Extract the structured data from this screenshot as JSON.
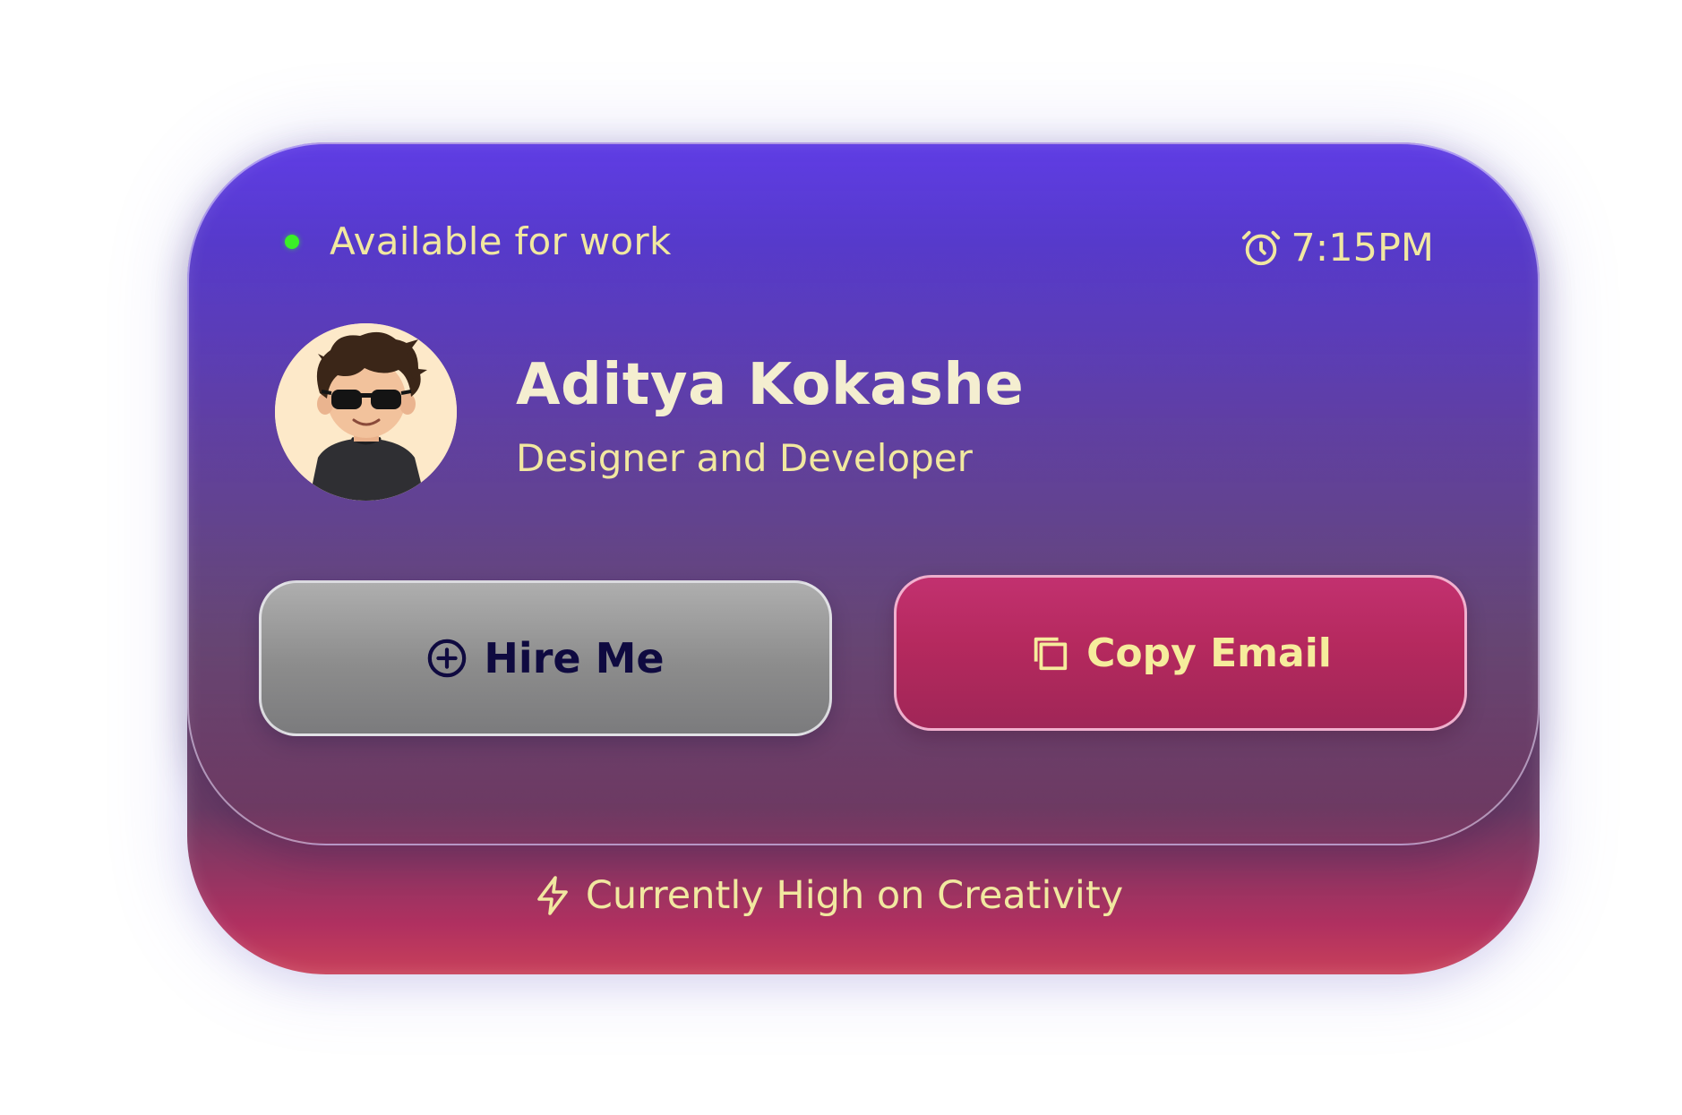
{
  "status": {
    "label": "Available for work",
    "dot_color": "#3af027"
  },
  "time": {
    "icon": "alarm-clock-icon",
    "value": "7:15PM"
  },
  "profile": {
    "name": "Aditya Kokashe",
    "role": "Designer and Developer",
    "avatar": "cartoon-avatar-with-sunglasses"
  },
  "buttons": {
    "hire": {
      "label": "Hire Me",
      "icon": "plus-circle-icon"
    },
    "copy": {
      "label": "Copy Email",
      "icon": "copy-icon"
    }
  },
  "footer": {
    "label": "Currently High on Creativity",
    "icon": "lightning-icon"
  },
  "colors": {
    "accent_text": "#f1e8a0",
    "card_top": "#5e3ce5",
    "card_bottom": "#c8405a",
    "copy_button": "#b5295e",
    "hire_button": "#8c8c8c"
  }
}
